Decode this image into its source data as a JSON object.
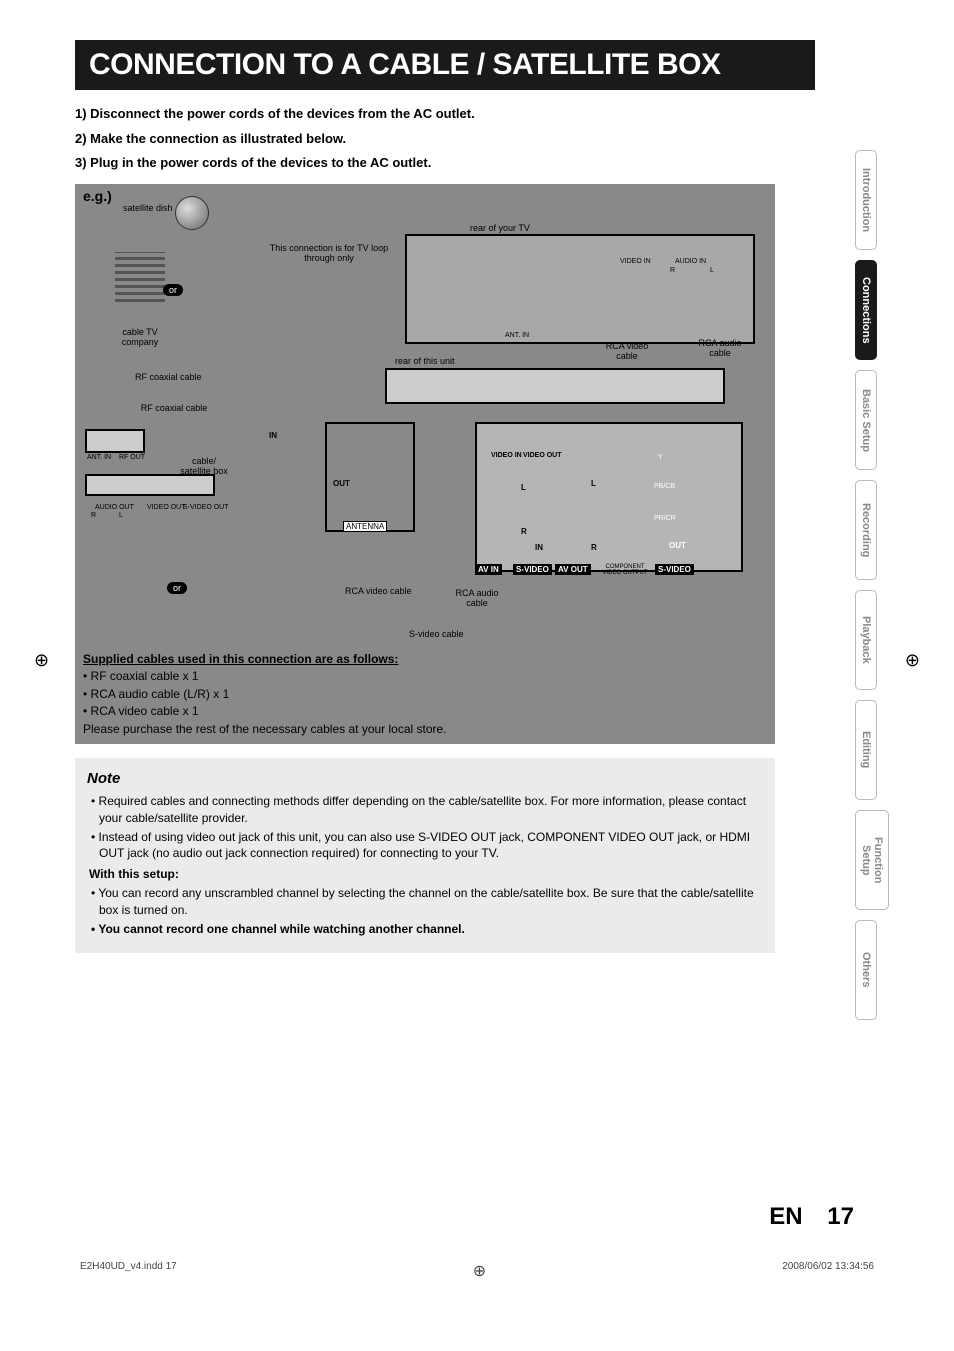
{
  "topMark": "⊕",
  "title": "CONNECTION TO A CABLE / SATELLITE BOX",
  "steps": {
    "s1": "1) Disconnect the power cords of the devices from the AC outlet.",
    "s2": "2) Make the connection as illustrated below.",
    "s3": "3) Plug in the power cords of the devices to the AC outlet."
  },
  "diagram": {
    "eg": "e.g.)",
    "satDish": "satellite dish",
    "cableCo": "cable TV company",
    "or1": "or",
    "or2": "or",
    "loopThrough": "This connection is for TV loop through only",
    "rearTV": "rear of your TV",
    "videoIn": "VIDEO IN",
    "audioIn": "AUDIO IN",
    "audioR": "R",
    "audioL": "L",
    "antIn": "ANT. IN",
    "rcaVideoCableTop": "RCA video cable",
    "rcaAudioCableTop": "RCA audio cable",
    "rearUnit": "rear of this unit",
    "rfCoax1": "RF coaxial cable",
    "rfCoax2": "RF coaxial cable",
    "antInLbl": "ANT. IN",
    "rfOut": "RF OUT",
    "cableSatBox": "cable/ satellite box",
    "inLbl": "IN",
    "outLbl": "OUT",
    "antenna": "ANTENNA",
    "audioOut": "AUDIO OUT",
    "videoOut": "VIDEO OUT",
    "sVideoOut": "S-VIDEO OUT",
    "rcaVideoCableBottom": "RCA video cable",
    "rcaAudioCableBottom": "RCA audio cable",
    "sVideoCableBottom": "S-video cable",
    "avIn": "AV IN",
    "sVideo": "S-VIDEO",
    "avOut": "AV OUT",
    "component": "COMPONENT VIDEO OUTPUT",
    "sVideoRight": "S-VIDEO",
    "videoInPort": "VIDEO IN",
    "videoOutPort": "VIDEO OUT",
    "L": "L",
    "R": "R",
    "IN": "IN",
    "outRight": "OUT",
    "Y": "Y",
    "PbCb": "PB/CB",
    "PrCr": "PR/CR"
  },
  "supplied": {
    "title": "Supplied cables used in this connection are as follows:",
    "i1": "• RF coaxial cable x 1",
    "i2": "• RCA audio cable (L/R) x 1",
    "i3": "• RCA video cable x 1",
    "extra": "Please purchase the rest of the necessary cables at your local store."
  },
  "note": {
    "title": "Note",
    "n1": "Required cables and connecting methods differ depending on the cable/satellite box. For more information, please contact your cable/satellite provider.",
    "n2": "Instead of using video out jack of this unit, you can also use S-VIDEO OUT jack, COMPONENT VIDEO OUT jack, or HDMI OUT jack (no audio out jack connection required) for connecting to your TV.",
    "withSetup": "With this setup:",
    "n3": "You can record any unscrambled channel by selecting the channel on the cable/satellite box. Be sure that the cable/satellite box is turned on.",
    "n4": "You cannot record one channel while watching another channel."
  },
  "tabs": {
    "t1": "Introduction",
    "t2": "Connections",
    "t3": "Basic Setup",
    "t4": "Recording",
    "t5": "Playback",
    "t6": "Editing",
    "t7": "Function Setup",
    "t8": "Others"
  },
  "footer": {
    "en": "EN",
    "pageNum": "17",
    "file": "E2H40UD_v4.indd   17",
    "timestamp": "2008/06/02   13:34:56"
  }
}
